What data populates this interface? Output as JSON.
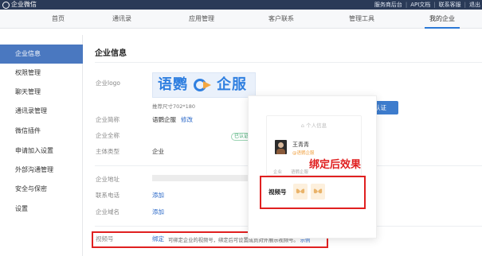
{
  "topbar": {
    "brand": "企业微信",
    "links": [
      "服务商后台",
      "API文档",
      "联系客服",
      "退出"
    ],
    "separator": "|"
  },
  "nav": {
    "items": [
      "首页",
      "通讯录",
      "应用管理",
      "客户联系",
      "管理工具",
      "我的企业"
    ],
    "active": "我的企业"
  },
  "sidebar": {
    "items": [
      "企业信息",
      "权限管理",
      "聊天管理",
      "通讯录管理",
      "微信插件",
      "申请加入设置",
      "外部沟通管理",
      "安全与保密",
      "设置"
    ],
    "active": "企业信息"
  },
  "main": {
    "title": "企业信息",
    "logo_label": "企业logo",
    "logo_text_left": "语鹦",
    "logo_text_right": "企服",
    "logo_hint": "推荐尺寸702*180",
    "abbr_label": "企业简称",
    "abbr_value": "语鹦企服",
    "abbr_edit": "修改",
    "fullname_label": "企业全称",
    "fullname_badge": "已认证",
    "type_label": "主体类型",
    "type_value": "企业",
    "address_label": "企业地址",
    "phone_label": "联系电话",
    "phone_value": "添加",
    "domain_label": "企业域名",
    "domain_value": "添加",
    "cert_button": "企业微信认证",
    "wx_label": "视频号",
    "wx_bind": "绑定",
    "wx_hint": "可绑定企业的视频号，绑定后可设置成员对外展示视频号。",
    "wx_example": "示例"
  },
  "popup": {
    "card_title": "个人信息",
    "name": "王青青",
    "subtitle": "@语鹦企服",
    "corp_label": "企业",
    "corp_value": "语鹦企服",
    "effect_text": "绑定后效果",
    "wx_label": "视频号"
  },
  "colors": {
    "accent": "#2a68c8",
    "sidebar_active": "#4a78c0",
    "topbar": "#2a3a57",
    "highlight": "#e02020"
  }
}
